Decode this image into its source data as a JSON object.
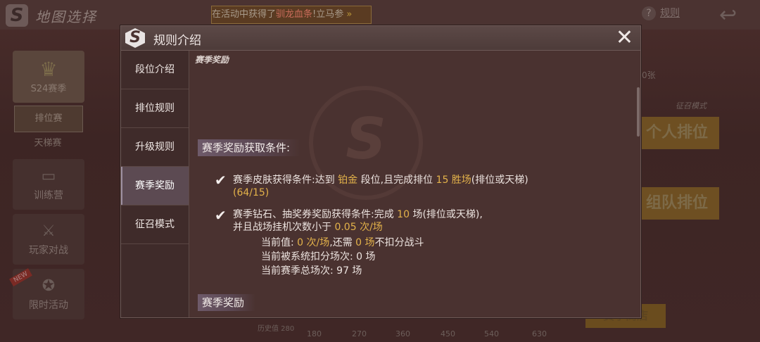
{
  "background": {
    "title": "地图选择",
    "ticker": {
      "prefix": "在活动中获得了",
      "highlight": "驯龙血条",
      "suffix": "!立马参"
    },
    "rules_link": "规则",
    "season_label": "S24赛季",
    "ranked_label": "排位赛",
    "ladder_label": "天梯赛",
    "training_label": "训练营",
    "pvp_label": "玩家对战",
    "limited_label": "限时活动",
    "new_tag": "NEW",
    "summon_mode_label": "征召模式",
    "count_label": "0张",
    "solo_rank_button": "个人排位",
    "team_rank_button": "组队排位",
    "shop_button": "赛季商店",
    "history_points": "历史值 280",
    "milestones": [
      "180",
      "270",
      "360",
      "450",
      "540",
      "630"
    ]
  },
  "modal": {
    "title": "规则介绍",
    "close_icon": "close-icon",
    "tabs": [
      {
        "label": "段位介绍",
        "active": false
      },
      {
        "label": "排位规则",
        "active": false
      },
      {
        "label": "升级规则",
        "active": false
      },
      {
        "label": "赛季奖励",
        "active": true
      },
      {
        "label": "征召模式",
        "active": false
      }
    ],
    "content": {
      "heading": "赛季奖励",
      "section1_title": "赛季奖励获取条件:",
      "cond1": {
        "a": "赛季皮肤获得条件:达到 ",
        "rank": "铂金",
        "b": " 段位,且完成排位 ",
        "wins": "15 胜场",
        "c": "(排位或天梯)",
        "progress": "(64/15)"
      },
      "cond2": {
        "a": "赛季钻石、抽奖券奖励获得条件:完成 ",
        "games": "10",
        "b": " 场(排位或天梯),",
        "c": "并且战场挂机次数小于 ",
        "afk": "0.05 次/场"
      },
      "details": {
        "current_label": "当前值: ",
        "current_val": "0 次/场",
        "need_label": ",还需 ",
        "need_val": "0 场",
        "need_suffix": "不扣分战斗",
        "deducted": "当前被系统扣分场次: 0 场",
        "total": "当前赛季总场次: 97 场"
      },
      "section2_title": "赛季奖励"
    }
  },
  "colors": {
    "accent_yellow": "#e3b24a",
    "modal_bg": "#4a3230",
    "tab_active": "#5c4a52"
  }
}
